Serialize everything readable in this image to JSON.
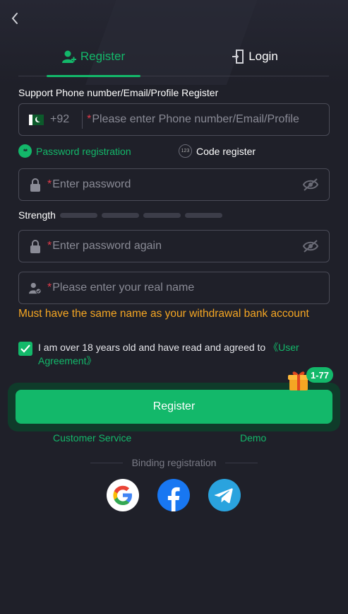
{
  "tabs": {
    "register": "Register",
    "login": "Login"
  },
  "section_label": "Support Phone number/Email/Profile Register",
  "phone": {
    "country_code": "+92",
    "required_mark": "*",
    "placeholder": "Please enter Phone number/Email/Profile"
  },
  "modes": {
    "password": "Password registration",
    "code": "Code register",
    "password_icon_text": "**",
    "code_icon_text": "123"
  },
  "password": {
    "required_mark": "*",
    "placeholder": "Enter password"
  },
  "strength": {
    "label": "Strength",
    "bars": 4
  },
  "password_again": {
    "required_mark": "*",
    "placeholder": "Enter password again"
  },
  "real_name": {
    "required_mark": "*",
    "placeholder": "Please enter your real name"
  },
  "warning": "Must have the same name as your withdrawal bank account",
  "agreement": {
    "text": "I am over 18 years old and have read and agreed to ",
    "link": "《User Agreement》",
    "checked": true
  },
  "register_button": "Register",
  "gift_badge": "1-77",
  "links": {
    "customer_service": "Customer Service",
    "demo": "Demo"
  },
  "binding_label": "Binding registration",
  "social": [
    "google-icon",
    "facebook-icon",
    "telegram-icon"
  ],
  "colors": {
    "accent": "#13b86a",
    "background": "#1f2029",
    "warning": "#f5a623",
    "required": "#e23b4a"
  }
}
